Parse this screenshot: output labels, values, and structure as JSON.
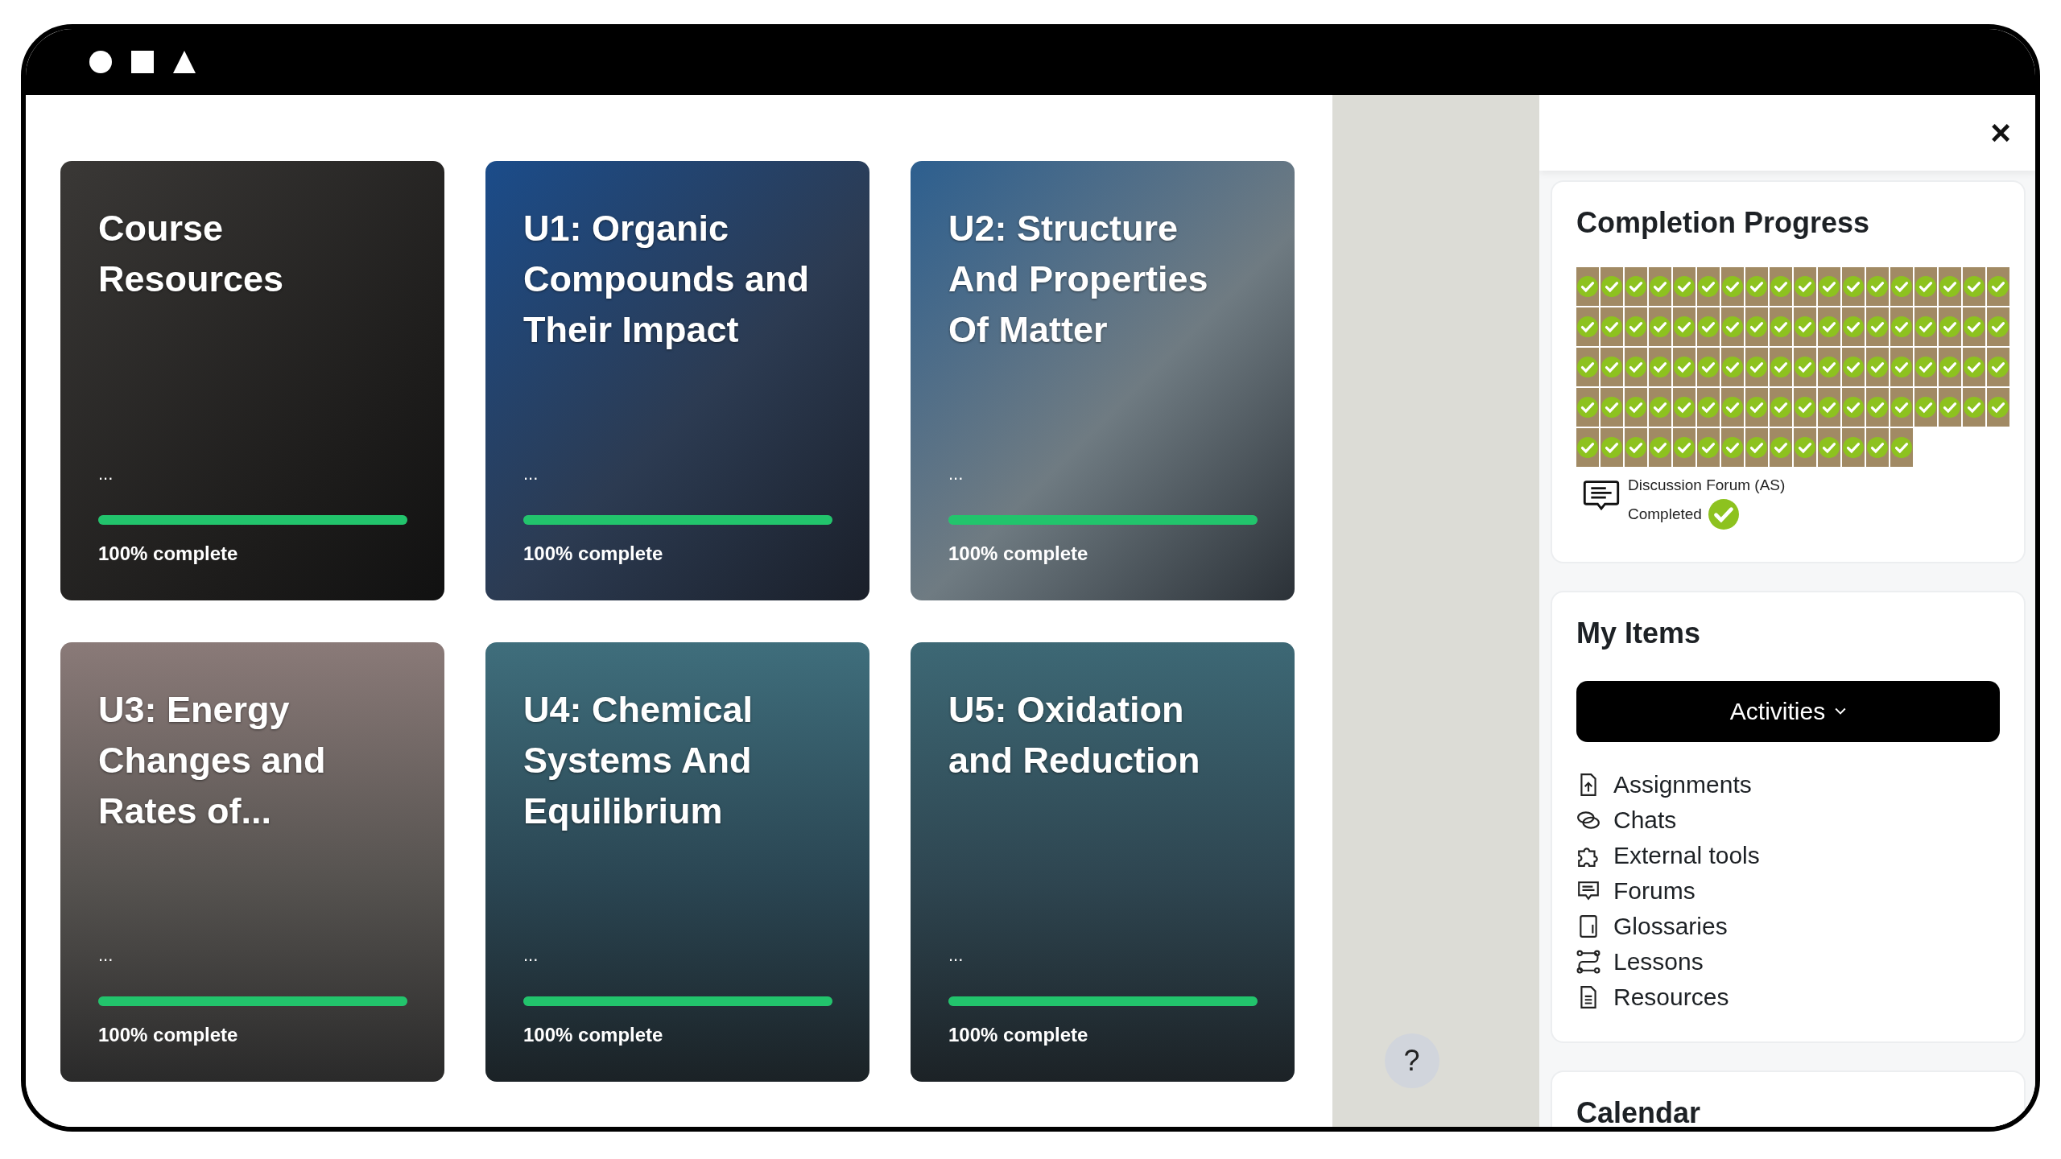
{
  "courses": [
    {
      "title": "Course Resources",
      "excerpt": "...",
      "progress_label": "100% complete",
      "level": 1
    },
    {
      "title": "U1: Organic Compounds and Their Impact",
      "excerpt": "...",
      "progress_label": "100% complete",
      "level": 1
    },
    {
      "title": "U2: Structure And Properties Of Matter",
      "excerpt": "...",
      "progress_label": "100% complete",
      "level": 1
    },
    {
      "title": "U3: Energy Changes and Rates of...",
      "excerpt": "...",
      "progress_label": "100% complete",
      "level": 1
    },
    {
      "title": "U4: Chemical Systems And Equilibrium",
      "excerpt": "...",
      "progress_label": "100% complete",
      "level": 1
    },
    {
      "title": "U5: Oxidation and Reduction",
      "excerpt": "...",
      "progress_label": "100% complete",
      "level": 1
    }
  ],
  "help_button": {
    "label": "?"
  },
  "drawer": {
    "close": "×"
  },
  "completion_progress": {
    "title": "Completion Progress",
    "cells": [
      {
        "completed": true
      },
      {
        "completed": true
      },
      {
        "completed": true
      },
      {
        "completed": true
      },
      {
        "completed": true
      },
      {
        "completed": true
      },
      {
        "completed": true
      },
      {
        "completed": true
      },
      {
        "completed": true
      },
      {
        "completed": true
      },
      {
        "completed": true
      },
      {
        "completed": true
      },
      {
        "completed": true
      },
      {
        "completed": true
      },
      {
        "completed": true
      },
      {
        "completed": true
      },
      {
        "completed": true
      },
      {
        "completed": true
      },
      {
        "completed": true
      },
      {
        "completed": true
      },
      {
        "completed": true
      },
      {
        "completed": true
      },
      {
        "completed": true
      },
      {
        "completed": true
      },
      {
        "completed": true
      },
      {
        "completed": true
      },
      {
        "completed": true
      },
      {
        "completed": true
      },
      {
        "completed": true
      },
      {
        "completed": true
      },
      {
        "completed": true
      },
      {
        "completed": true
      },
      {
        "completed": true
      },
      {
        "completed": true
      },
      {
        "completed": true
      },
      {
        "completed": true
      },
      {
        "completed": true
      },
      {
        "completed": true
      },
      {
        "completed": true
      },
      {
        "completed": true
      },
      {
        "completed": true
      },
      {
        "completed": true
      },
      {
        "completed": true
      },
      {
        "completed": true
      },
      {
        "completed": true
      },
      {
        "completed": true
      },
      {
        "completed": true
      },
      {
        "completed": true
      },
      {
        "completed": true
      },
      {
        "completed": true
      },
      {
        "completed": true
      },
      {
        "completed": true
      },
      {
        "completed": true
      },
      {
        "completed": true
      },
      {
        "completed": true
      },
      {
        "completed": true
      },
      {
        "completed": true
      },
      {
        "completed": true
      },
      {
        "completed": true
      },
      {
        "completed": true
      },
      {
        "completed": true
      },
      {
        "completed": true
      },
      {
        "completed": true
      },
      {
        "completed": true
      },
      {
        "completed": true
      },
      {
        "completed": true
      },
      {
        "completed": true
      },
      {
        "completed": true
      },
      {
        "completed": true
      },
      {
        "completed": true
      },
      {
        "completed": true
      },
      {
        "completed": true
      },
      {
        "completed": true
      },
      {
        "completed": true
      },
      {
        "completed": true
      },
      {
        "completed": true
      },
      {
        "completed": true
      },
      {
        "completed": true
      },
      {
        "completed": true
      },
      {
        "completed": true
      },
      {
        "completed": true
      },
      {
        "completed": true
      },
      {
        "completed": true
      },
      {
        "completed": true
      },
      {
        "completed": true
      },
      {
        "completed": true
      }
    ],
    "detail": {
      "name": "Discussion Forum (AS)",
      "status": "Completed",
      "completed": true
    }
  },
  "my_items": {
    "title": "My Items",
    "dropdown": "Activities",
    "items": [
      {
        "label": "Assignments",
        "kind": "assignment"
      },
      {
        "label": "Chats",
        "kind": "chat"
      },
      {
        "label": "External tools",
        "kind": "tool"
      },
      {
        "label": "Forums",
        "kind": "forum"
      },
      {
        "label": "Glossaries",
        "kind": "glossary"
      },
      {
        "label": "Lessons",
        "kind": "lesson"
      },
      {
        "label": "Resources",
        "kind": "resource"
      }
    ]
  },
  "calendar": {
    "title": "Calendar"
  }
}
